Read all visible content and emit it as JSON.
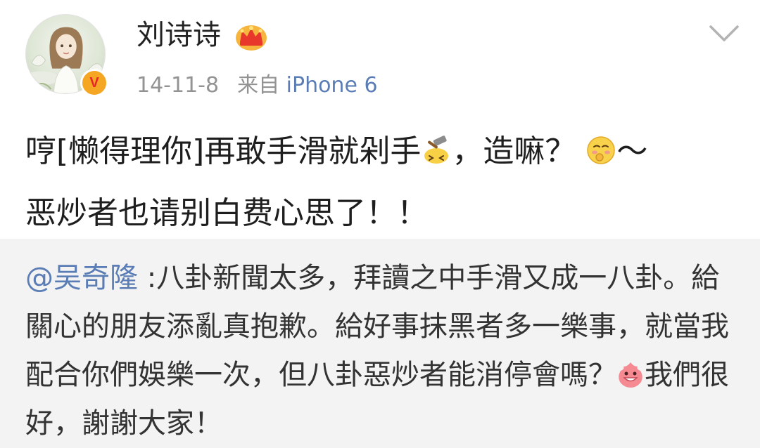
{
  "header": {
    "username": "刘诗诗",
    "timestamp": "14-11-8",
    "source_prefix": "来自",
    "device": "iPhone 6",
    "verified_badge": "V",
    "icons": [
      "avatar",
      "verified-badge-icon",
      "crown-icon",
      "chevron-down-icon"
    ]
  },
  "post": {
    "part1": "哼[懒得理你]再敢手滑就剁手",
    "emoji1": "hammer-emoji-icon",
    "part2": "，造嘛？ ",
    "emoji2": "shy-face-emoji-icon",
    "part3": "～",
    "line2": "恶炒者也请别白费心思了！！"
  },
  "repost": {
    "mention": "@吴奇隆",
    "text1": " :八卦新聞太多，拜讀之中手滑又成一八卦。給關心的朋友添亂真抱歉。給好事抹黑者多一樂事，就當我配合你們娛樂一次，但八卦惡炒者能消停會嗎？",
    "emoji": "pink-monster-emoji-icon",
    "text2": "我們很好，謝謝大家！"
  },
  "colors": {
    "link": "#5b7db6",
    "meta": "#939393",
    "repost_bg": "#f3f3f3",
    "badge_bg": "#f5a623",
    "badge_text": "#e8262a"
  }
}
